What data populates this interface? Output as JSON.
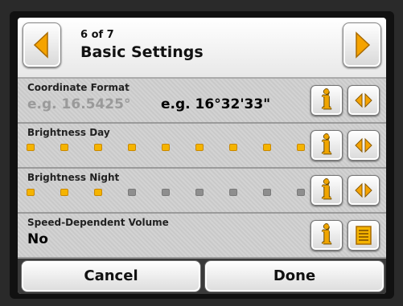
{
  "header": {
    "page_counter": "6 of 7",
    "title": "Basic Settings",
    "prev_icon": "arrow-left-icon",
    "next_icon": "arrow-right-icon"
  },
  "settings": [
    {
      "label": "Coordinate Format",
      "option_inactive": "e.g. 16.5425°",
      "option_active": "e.g. 16°32'33\"",
      "info_icon": "info-icon",
      "action_icon": "toggle-arrows-icon"
    },
    {
      "label": "Brightness Day",
      "level": 9,
      "max": 9,
      "info_icon": "info-icon",
      "action_icon": "toggle-arrows-icon"
    },
    {
      "label": "Brightness Night",
      "level": 3,
      "max": 9,
      "info_icon": "info-icon",
      "action_icon": "toggle-arrows-icon"
    },
    {
      "label": "Speed-Dependent Volume",
      "value": "No",
      "info_icon": "info-icon",
      "action_icon": "list-icon"
    }
  ],
  "info_glyph": "i",
  "footer": {
    "cancel_label": "Cancel",
    "done_label": "Done"
  },
  "colors": {
    "accent": "#f5b400",
    "inactive_dot": "#8e8e8e"
  }
}
